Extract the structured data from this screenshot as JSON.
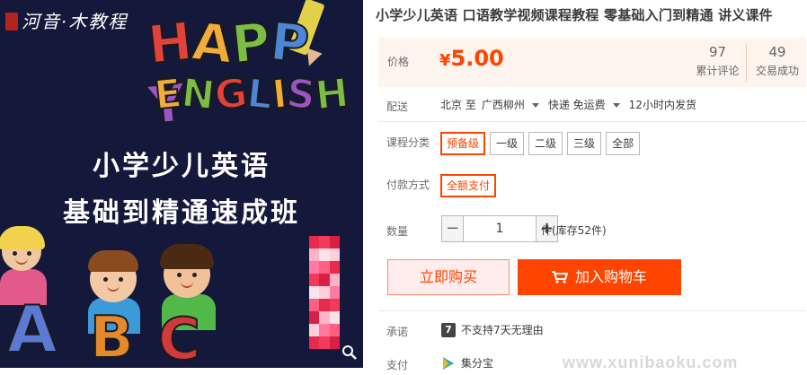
{
  "gallery": {
    "logo_script": "河音·木教程",
    "logo_subtitle": "",
    "happy_letters": [
      {
        "ch": "H",
        "color": "#e2423b"
      },
      {
        "ch": "A",
        "color": "#f0ad3a"
      },
      {
        "ch": "P",
        "color": "#7dbc47"
      },
      {
        "ch": "P",
        "color": "#4c86d9"
      },
      {
        "ch": "Y",
        "color": "#9a56c7"
      }
    ],
    "english_letters": [
      {
        "ch": "E",
        "color": "#f0ad3a"
      },
      {
        "ch": "N",
        "color": "#7dbc47"
      },
      {
        "ch": "G",
        "color": "#e2423b"
      },
      {
        "ch": "L",
        "color": "#4c86d9"
      },
      {
        "ch": "I",
        "color": "#f0ad3a"
      },
      {
        "ch": "S",
        "color": "#9a56c7"
      },
      {
        "ch": "H",
        "color": "#7dbc47"
      }
    ],
    "headline_1": "小学少儿英语",
    "headline_2": "基础到精通速成班",
    "letter_a": "A",
    "letter_b": "B",
    "letter_c": "C"
  },
  "product": {
    "title": "小学少儿英语 口语教学视频课程教程 零基础入门到精通 讲义课件"
  },
  "price": {
    "label": "价格",
    "symbol": "¥",
    "value": "5.00",
    "reviews_count": "97",
    "reviews_label": "累计评论",
    "deals_count": "49",
    "deals_label": "交易成功"
  },
  "shipping": {
    "label": "配送",
    "from": "北京 至",
    "to": "广西柳州",
    "method": "快递 免运费",
    "dispatch": "12小时内发货"
  },
  "category": {
    "label": "课程分类",
    "options": [
      "预备级",
      "一级",
      "二级",
      "三级",
      "全部"
    ],
    "selected_index": 0
  },
  "payment_mode": {
    "label": "付款方式",
    "options": [
      "全额支付"
    ],
    "selected_index": 0
  },
  "quantity": {
    "label": "数量",
    "value": "1",
    "minus": "−",
    "plus": "+",
    "stock_text": "件(库存52件)"
  },
  "actions": {
    "buy_now": "立即购买",
    "add_to_cart": "加入购物车"
  },
  "promise": {
    "label": "承诺",
    "badge": "7",
    "text": "不支持7天无理由"
  },
  "pay": {
    "label": "支付",
    "text": "集分宝"
  },
  "watermark": "www.xunibaoku.com",
  "colors": {
    "accent": "#ff4400",
    "price_bg": "#fef4ee",
    "gallery_bg": "#14183a"
  }
}
